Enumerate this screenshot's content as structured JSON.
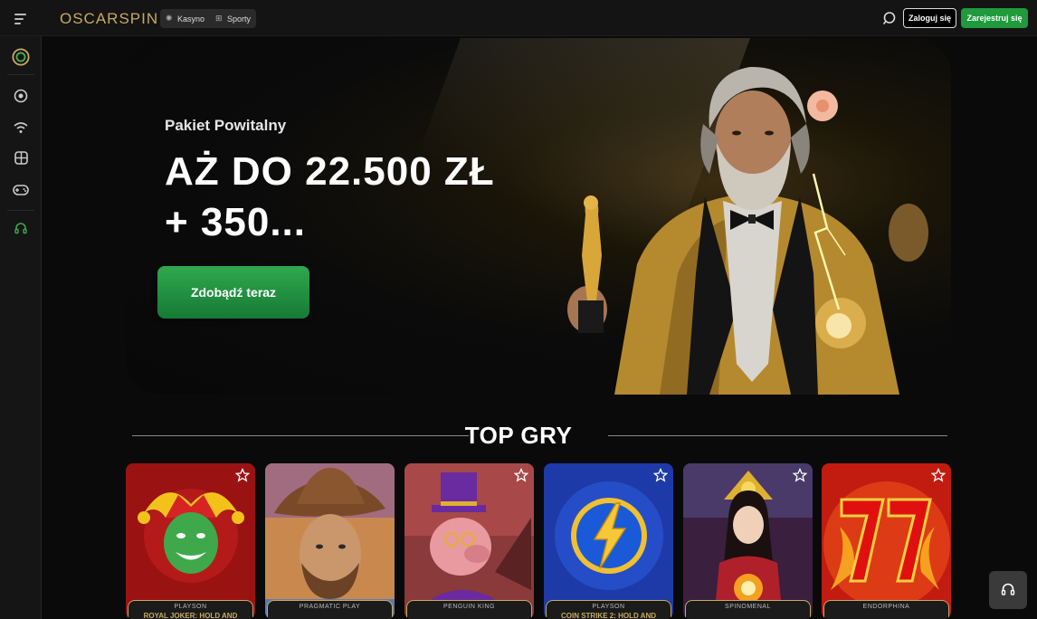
{
  "header": {
    "logo": "OSCARSPIN",
    "categories": [
      {
        "label": "Kasyno",
        "icon": "casino-chip-icon"
      },
      {
        "label": "Sporty",
        "icon": "sports-icon"
      }
    ],
    "login_label": "Zaloguj się",
    "register_label": "Zarejestruj się"
  },
  "sidebar": {
    "items": [
      {
        "name": "oscar-logo-icon"
      },
      {
        "name": "casino-chip-icon"
      },
      {
        "name": "live-signal-icon"
      },
      {
        "name": "slots-icon"
      },
      {
        "name": "gamepad-icon"
      },
      {
        "name": "support-headset-icon"
      }
    ]
  },
  "hero": {
    "subtitle": "Pakiet Powitalny",
    "title_line1": "AŻ DO 22.500 ZŁ",
    "title_line2": "+ 350...",
    "cta_label": "Zdobądź teraz"
  },
  "top_games": {
    "title": "TOP GRY",
    "games": [
      {
        "provider": "PLAYSON",
        "name": "ROYAL JOKER: HOLD AND",
        "bg": "#9b1212"
      },
      {
        "provider": "PRAGMATIC PLAY",
        "name": "",
        "bg": "#8a5a3a"
      },
      {
        "provider": "PENGUIN KING",
        "name": "",
        "bg": "#7a2f4a"
      },
      {
        "provider": "PLAYSON",
        "name": "COIN STRIKE 2: HOLD AND",
        "bg": "#1d3aa8"
      },
      {
        "provider": "SPINOMENAL",
        "name": "",
        "bg": "#3a1f3e"
      },
      {
        "provider": "ENDORPHINA",
        "name": "",
        "bg": "#c21c10"
      }
    ]
  },
  "colors": {
    "brand_gold": "#c9a961",
    "accent_green": "#1f9a3d"
  }
}
